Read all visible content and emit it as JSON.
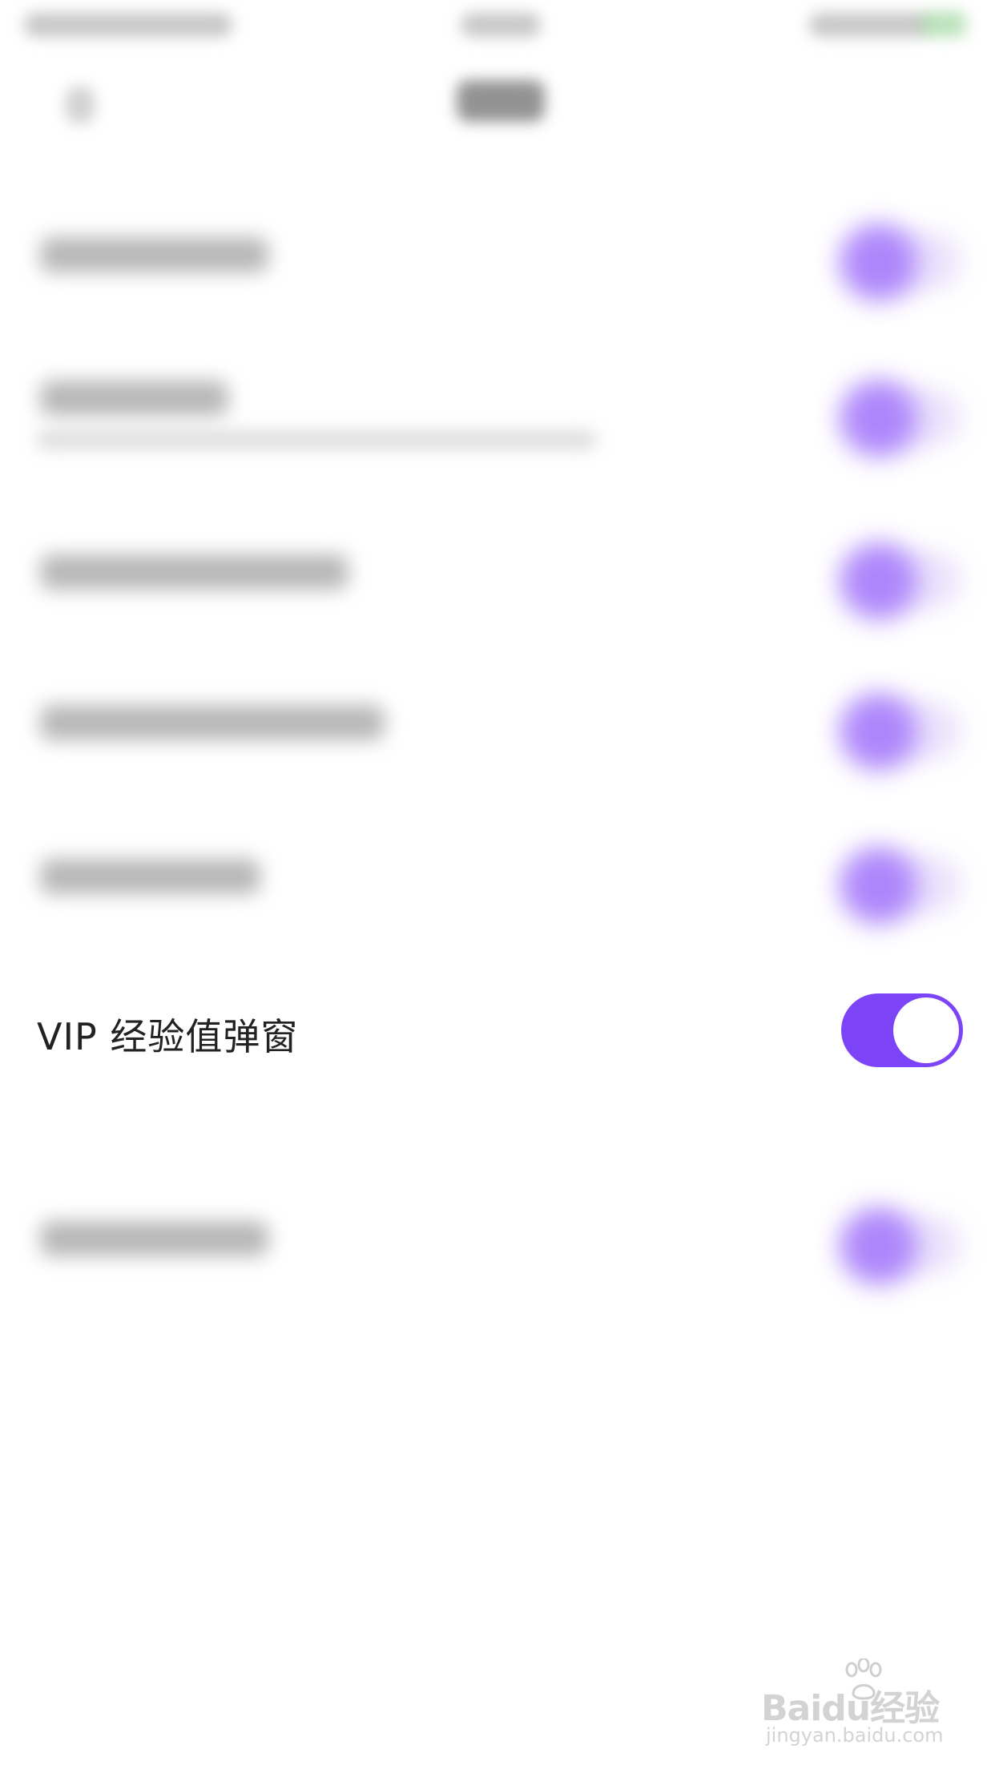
{
  "settings": {
    "vip_popup": {
      "label": "VIP 经验值弹窗",
      "enabled": true
    }
  },
  "colors": {
    "accent": "#7d43f7",
    "text": "#222222",
    "background": "#ffffff"
  },
  "watermark": {
    "brand": "Baidu经验",
    "url": "jingyan.baidu.com"
  }
}
